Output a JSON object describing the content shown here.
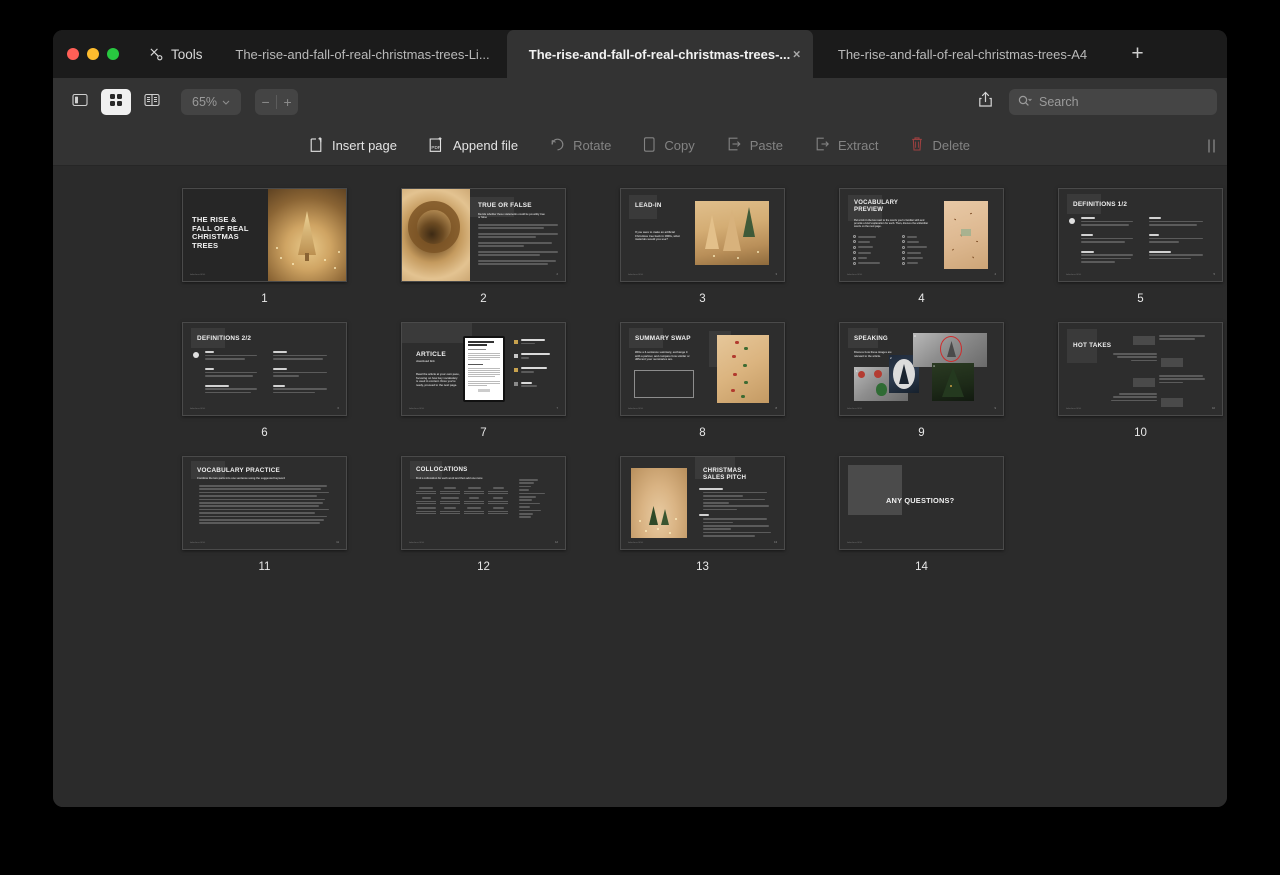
{
  "window": {
    "traffic_lights": [
      {
        "name": "close",
        "color": "#ff5f57"
      },
      {
        "name": "minimize",
        "color": "#febc2e"
      },
      {
        "name": "zoom",
        "color": "#28c840"
      }
    ],
    "tools_label": "Tools"
  },
  "tabs": [
    {
      "label": "The-rise-and-fall-of-real-christmas-trees-Li...",
      "active": false,
      "closable": false
    },
    {
      "label": "The-rise-and-fall-of-real-christmas-trees-...",
      "active": true,
      "closable": true,
      "close_glyph": "×"
    },
    {
      "label": "The-rise-and-fall-of-real-christmas-trees-A4",
      "active": false,
      "closable": false
    }
  ],
  "new_tab_label": "+",
  "toolbar": {
    "sidebar_icon": "sidebar-icon",
    "thumbnails_icon": "grid-view-icon",
    "contactsheet_icon": "page-view-icon",
    "zoom_value": "65%",
    "zoom_chevron": "⌄",
    "zoom_out": "−",
    "zoom_in": "+",
    "share_icon": "share-icon",
    "search_placeholder": "Search",
    "search_value": ""
  },
  "actionbar": {
    "items": [
      {
        "label": "Insert page",
        "icon": "insert-page-icon",
        "enabled": true
      },
      {
        "label": "Append file",
        "icon": "append-file-icon",
        "enabled": true
      },
      {
        "label": "Rotate",
        "icon": "rotate-icon",
        "enabled": false
      },
      {
        "label": "Copy",
        "icon": "copy-icon",
        "enabled": false
      },
      {
        "label": "Paste",
        "icon": "paste-icon",
        "enabled": false
      },
      {
        "label": "Extract",
        "icon": "extract-icon",
        "enabled": false
      },
      {
        "label": "Delete",
        "icon": "trash-icon",
        "enabled": false
      }
    ],
    "grip_icon": "drag-grip-icon"
  },
  "pages": [
    {
      "number": "1",
      "title": "THE RISE &\nFALL OF REAL\nCHRISTMAS\nTREES",
      "layout": "cover-split",
      "photo": "gold-christmas-tree-with-fairy-lights"
    },
    {
      "number": "2",
      "title": "TRUE OR FALSE",
      "subtitle": "Decide whether these statements could be possibly true or false",
      "layout": "photo-left-text-right",
      "photo": "dried-wreath-on-beige-background",
      "list_count": 6
    },
    {
      "number": "3",
      "title": "LEAD-IN",
      "body": "If you were to make an artificial Christmas tree back in 1800s, what materials would you use?",
      "layout": "text-left-photo-right",
      "photo": "wooden-christmas-trees-with-lights"
    },
    {
      "number": "4",
      "title": "VOCABULARY\nPREVIEW",
      "subtitle": "Put a tick in the box next to the words you're familiar with and provide a brief explanation for each. Then, discuss the unfamiliar words on the next page.",
      "layout": "checklist-two-columns-photo",
      "photo": "scattered-pine-needles",
      "checklist_columns": 2,
      "checklist_rows": 6
    },
    {
      "number": "5",
      "title": "DEFINITIONS 1/2",
      "layout": "two-column-definitions",
      "entries": 6
    },
    {
      "number": "6",
      "title": "DEFINITIONS 2/2",
      "layout": "two-column-definitions",
      "entries": 6
    },
    {
      "number": "7",
      "title": "ARTICLE",
      "subtitle": "download link",
      "body": "Read the article at your own pace, focusing on how key vocabulary is used in context. Once you're ready, proceed to the next page.",
      "layout": "article-preview",
      "stats": [
        {
          "label": "Reading time",
          "value": "5 minutes"
        },
        {
          "label": "Number of words",
          "value": "994"
        },
        {
          "label": "New vocabulary",
          "value": "12 words"
        },
        {
          "label": "Level",
          "value": "Advanced"
        }
      ]
    },
    {
      "number": "8",
      "title": "SUMMARY SWAP",
      "body": "Write a 3-sentence summary, exchange it with a partner, and compare how similar or different your summaries are.",
      "layout": "text-with-answer-box-photo",
      "photo": "red-green-berry-garland"
    },
    {
      "number": "9",
      "title": "SPEAKING",
      "body": "Discuss how these images are relevant to the article.",
      "layout": "image-collage",
      "images": [
        {
          "number": "1",
          "desc": "vintage-storefront-christmas"
        },
        {
          "number": "2",
          "desc": "black-and-white-tree-ornament"
        },
        {
          "number": "3",
          "desc": "old-photo-with-red-circle"
        },
        {
          "number": "4",
          "desc": "green-christmas-tree-night"
        }
      ]
    },
    {
      "number": "10",
      "title": "HOT TAKES",
      "layout": "zigzag-statements",
      "statements": [
        {
          "num": "1",
          "text": "Real Christmas trees are just expensive fire hazards."
        },
        {
          "num": "2",
          "text": "Honestly, picking out a real Christmas tree is the best holiday tradition."
        },
        {
          "num": "3",
          "text": "Fake trees are great, but they feel a bit, too perfect, you know?"
        },
        {
          "num": "4",
          "text": "If you care about the environment, you shouldn't have a Christmas tree at all."
        }
      ]
    },
    {
      "number": "11",
      "title": "VOCABULARY PRACTICE",
      "subtitle": "Combine the two parts into one sentence using the suggested keyword",
      "layout": "numbered-list",
      "items": 12
    },
    {
      "number": "12",
      "title": "COLLOCATIONS",
      "subtitle": "Find a collocation for each word and then add one more",
      "layout": "collocation-grid",
      "grid_columns": 4,
      "grid_rows": 3,
      "right_column_items": 10
    },
    {
      "number": "13",
      "title": "CHRISTMAS\nSALES PITCH",
      "layout": "photo-left-list-right",
      "photo": "miniature-christmas-trees-with-lights"
    },
    {
      "number": "14",
      "title": "ANY QUESTIONS?",
      "layout": "closing-slide"
    }
  ]
}
